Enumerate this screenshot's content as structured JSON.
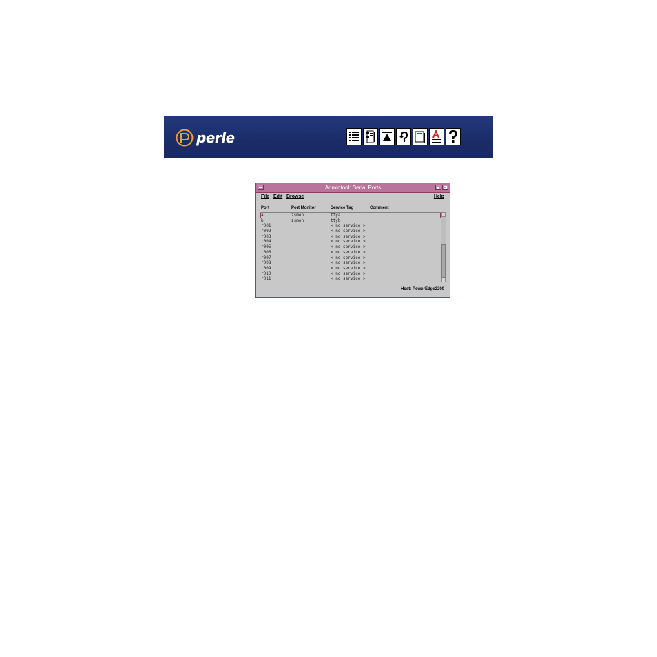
{
  "banner": {
    "logo_text": "perle",
    "accent_color": "#f0a030",
    "background_color": "#1c2f6e",
    "nav_icons": [
      "contents-icon",
      "index-icon",
      "top-icon",
      "back-icon",
      "document-icon",
      "text-icon",
      "help-icon"
    ]
  },
  "window": {
    "title": "Admintool: Serial Ports",
    "title_color": "#b8749a",
    "menu": {
      "file": "File",
      "edit": "Edit",
      "browse": "Browse",
      "help": "Help"
    },
    "columns": {
      "port": "Port",
      "monitor": "Port Monitor",
      "tag": "Service Tag",
      "comment": "Comment"
    },
    "rows": [
      {
        "port": "a",
        "monitor": "zsmon",
        "tag": "ttya"
      },
      {
        "port": "b",
        "monitor": "zsmon",
        "tag": "ttyb"
      },
      {
        "port": "r001",
        "monitor": "",
        "tag": "< no service >"
      },
      {
        "port": "r002",
        "monitor": "",
        "tag": "< no service >"
      },
      {
        "port": "r003",
        "monitor": "",
        "tag": "< no service >"
      },
      {
        "port": "r004",
        "monitor": "",
        "tag": "< no service >"
      },
      {
        "port": "r005",
        "monitor": "",
        "tag": "< no service >"
      },
      {
        "port": "r006",
        "monitor": "",
        "tag": "< no service >"
      },
      {
        "port": "r007",
        "monitor": "",
        "tag": "< no service >"
      },
      {
        "port": "r008",
        "monitor": "",
        "tag": "< no service >"
      },
      {
        "port": "r009",
        "monitor": "",
        "tag": "< no service >"
      },
      {
        "port": "r010",
        "monitor": "",
        "tag": "< no service >"
      },
      {
        "port": "r011",
        "monitor": "",
        "tag": "< no service >"
      }
    ],
    "host": "Host: PowerEdge2200"
  }
}
